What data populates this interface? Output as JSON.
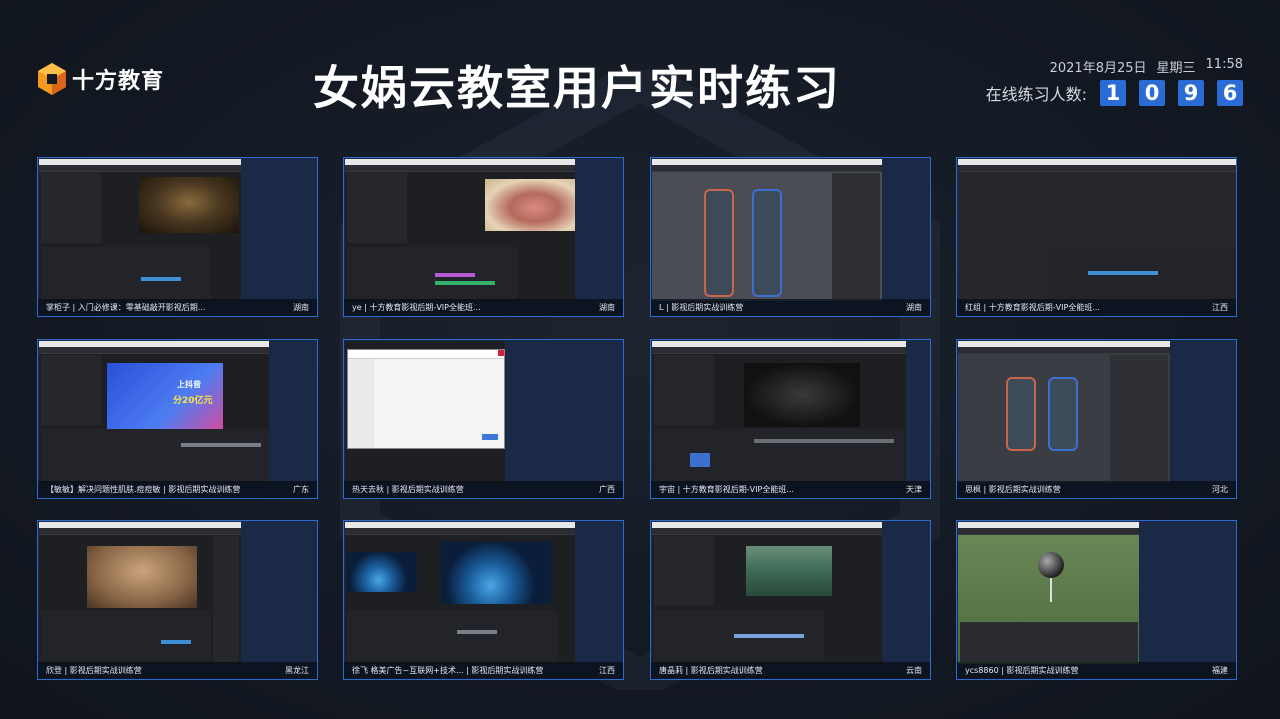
{
  "brand": {
    "logo_text": "十方教育",
    "accent": "#f39a1e"
  },
  "title": "女娲云教室用户实时练习",
  "datetime": {
    "date": "2021年8月25日",
    "weekday": "星期三",
    "time": "11:58"
  },
  "online": {
    "label": "在线练习人数:",
    "digits": [
      "1",
      "0",
      "9",
      "6"
    ],
    "color": "#2a6bd6"
  },
  "tiles": [
    {
      "caption": "掌柜子 | 入门必修课：零基础敲开影视后期...",
      "location": "湖南"
    },
    {
      "caption": "ye | 十方教育影视后期-VIP全能班...",
      "location": "湖南"
    },
    {
      "caption": "L | 影视后期实战训练营",
      "location": "湖南"
    },
    {
      "caption": "红组 | 十方教育影视后期-VIP全能班...",
      "location": "江西"
    },
    {
      "caption": "【敏敏】解决问题性肌肤.痘痘敏 | 影视后期实战训练营",
      "location": "广东"
    },
    {
      "caption": "热天去秋 | 影视后期实战训练营",
      "location": "广西"
    },
    {
      "caption": "宇宙 | 十方教育影视后期-VIP全能班...",
      "location": "天津"
    },
    {
      "caption": "思枫 | 影视后期实战训练营",
      "location": "河北"
    },
    {
      "caption": "欣登 | 影视后期实战训练营",
      "location": "黑龙江"
    },
    {
      "caption": "徐飞 格美广告~互联网+技术... | 影视后期实战训练营",
      "location": "江西"
    },
    {
      "caption": "唐晶莉 | 影视后期实战训练营",
      "location": "云南"
    },
    {
      "caption": "ycs8860 | 影视后期实战训练营",
      "location": "福建"
    }
  ],
  "ad_thumbnail": {
    "line1": "上抖音",
    "line2": "分20亿元"
  }
}
